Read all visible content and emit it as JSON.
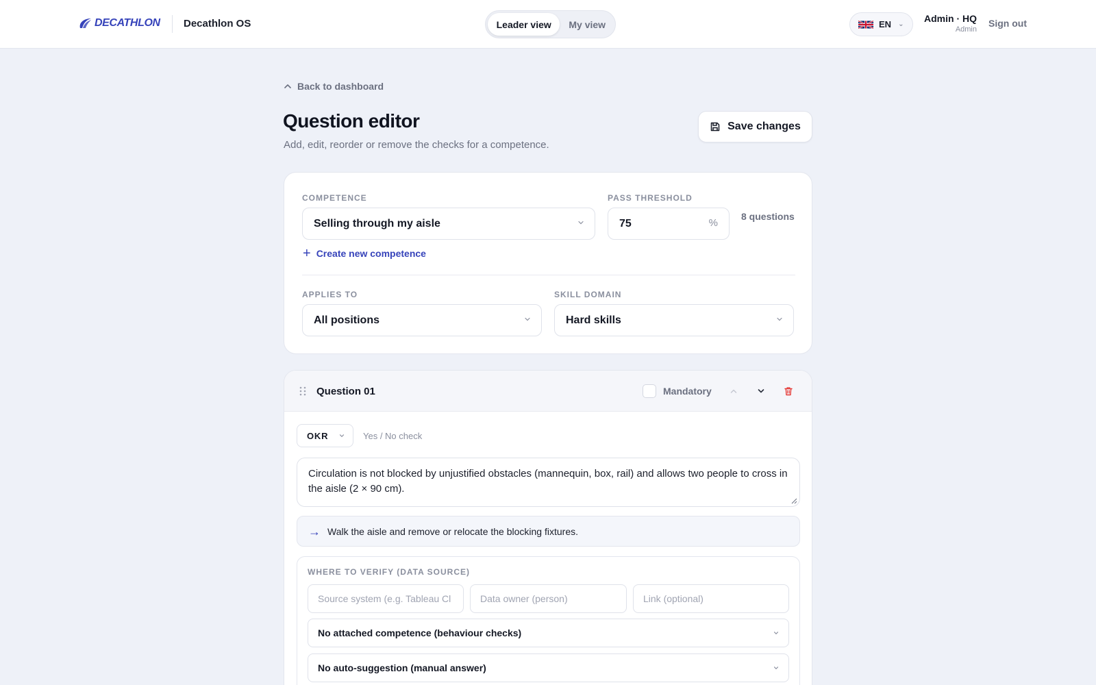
{
  "header": {
    "logo_text": "DECATHLON",
    "app_name": "Decathlon OS",
    "view_toggle": {
      "active": "Leader view",
      "inactive": "My view"
    },
    "language": "EN",
    "user": {
      "name": "Admin · HQ",
      "role": "Admin"
    },
    "sign_out": "Sign out"
  },
  "page": {
    "back_label": "Back to dashboard",
    "title": "Question editor",
    "subtitle": "Add, edit, reorder or remove the checks for a competence.",
    "save_label": "Save changes"
  },
  "settings": {
    "competence_label": "COMPETENCE",
    "competence_value": "Selling through my aisle",
    "threshold_label": "PASS THRESHOLD",
    "threshold_value": "75",
    "threshold_unit": "%",
    "question_count": "8 questions",
    "create_label": "Create new competence",
    "applies_label": "APPLIES TO",
    "applies_value": "All positions",
    "domain_label": "SKILL DOMAIN",
    "domain_value": "Hard skills"
  },
  "question": {
    "title": "Question 01",
    "mandatory_label": "Mandatory",
    "type_value": "OKR",
    "type_hint": "Yes / No check",
    "text": "Circulation is not blocked by unjustified obstacles (mannequin, box, rail) and allows two people to cross in the aisle (2 × 90 cm).",
    "action": "Walk the aisle and remove or relocate the blocking fixtures.",
    "verify": {
      "label": "WHERE TO VERIFY (DATA SOURCE)",
      "source_placeholder": "Source system (e.g. Tableau Cl",
      "owner_placeholder": "Data owner (person)",
      "link_placeholder": "Link (optional)",
      "attached_value": "No attached competence (behaviour checks)",
      "suggestion_value": "No auto-suggestion (manual answer)"
    }
  },
  "colors": {
    "brand": "#3643ba",
    "danger": "#e53935",
    "background": "#eef1f8"
  }
}
